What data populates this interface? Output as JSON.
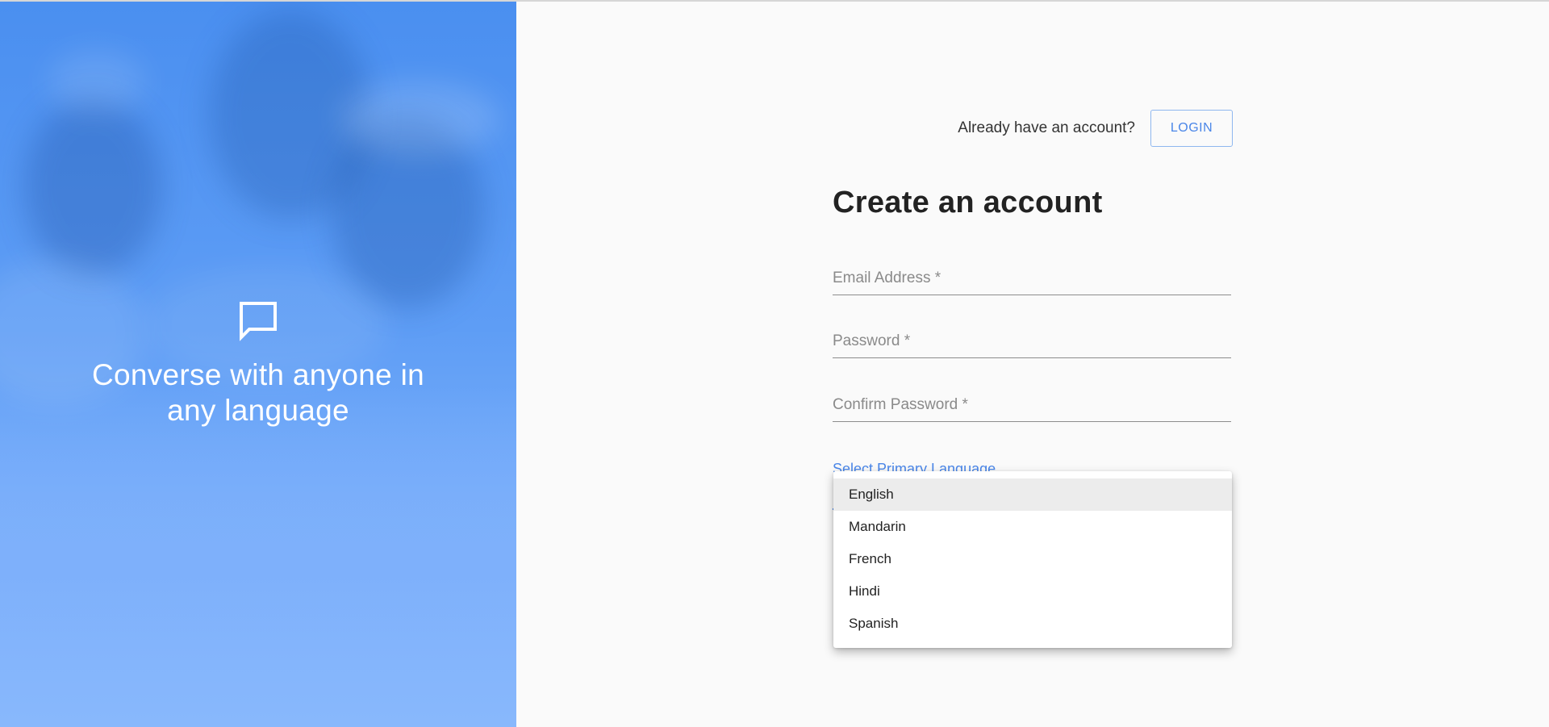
{
  "hero": {
    "icon": "chat-bubble-icon",
    "tagline": "Converse with anyone in any language"
  },
  "header": {
    "login_prompt": "Already have an account?",
    "login_label": "LOGIN"
  },
  "form": {
    "title": "Create an account",
    "email_placeholder": "Email Address *",
    "password_placeholder": "Password *",
    "confirm_password_placeholder": "Confirm Password *",
    "language_label": "Select Primary Language"
  },
  "language_dropdown": {
    "options": [
      "English",
      "Mandarin",
      "French",
      "Hindi",
      "Spanish"
    ],
    "selected": "English"
  },
  "colors": {
    "accent": "#4a86e8",
    "hero_top": "#4a8ff0",
    "hero_bottom": "#88b8fc"
  }
}
